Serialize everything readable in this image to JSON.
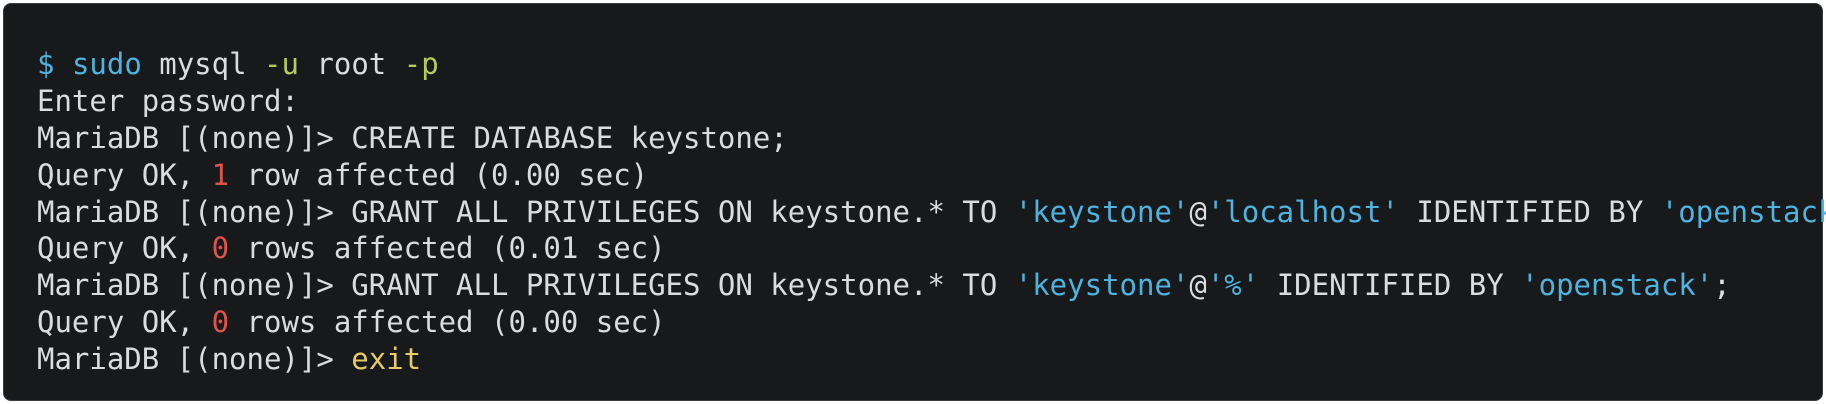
{
  "terminal": {
    "lines": {
      "l1": {
        "prompt": "$",
        "cmd": "sudo",
        "rest1": "mysql",
        "flag1": "-u",
        "rest2": "root",
        "flag2": "-p"
      },
      "l2": {
        "text": "Enter password:"
      },
      "l3": {
        "prompt": "MariaDB [(none)]>",
        "sql": "CREATE DATABASE keystone;"
      },
      "l4": {
        "a": "Query OK,",
        "num": "1",
        "b": "row affected (0.00 sec)"
      },
      "l5": {
        "prompt": "MariaDB [(none)]>",
        "sql": "GRANT ALL PRIVILEGES ON keystone.* TO",
        "user": "'keystone'",
        "at": "@",
        "host": "'localhost'",
        "mid": "IDENTIFIED BY",
        "pw": "'openstack'",
        "end": ";"
      },
      "l6": {
        "a": "Query OK,",
        "num": "0",
        "b": "rows affected (0.01 sec)"
      },
      "l7": {
        "prompt": "MariaDB [(none)]>",
        "sql": "GRANT ALL PRIVILEGES ON keystone.* TO",
        "user": "'keystone'",
        "at": "@",
        "host": "'%'",
        "mid": "IDENTIFIED BY",
        "pw": "'openstack'",
        "end": ";"
      },
      "l8": {
        "a": "Query OK,",
        "num": "0",
        "b": "rows affected (0.00 sec)"
      },
      "l9": {
        "prompt": "MariaDB [(none)]>",
        "cmd": "exit"
      }
    }
  },
  "colors": {
    "background": "#17191b",
    "text": "#dcdcdc",
    "keyword_blue": "#4fb3e0",
    "flag_green": "#b5cc5a",
    "number_red": "#e0524a",
    "exit_yellow": "#e4cc66"
  }
}
